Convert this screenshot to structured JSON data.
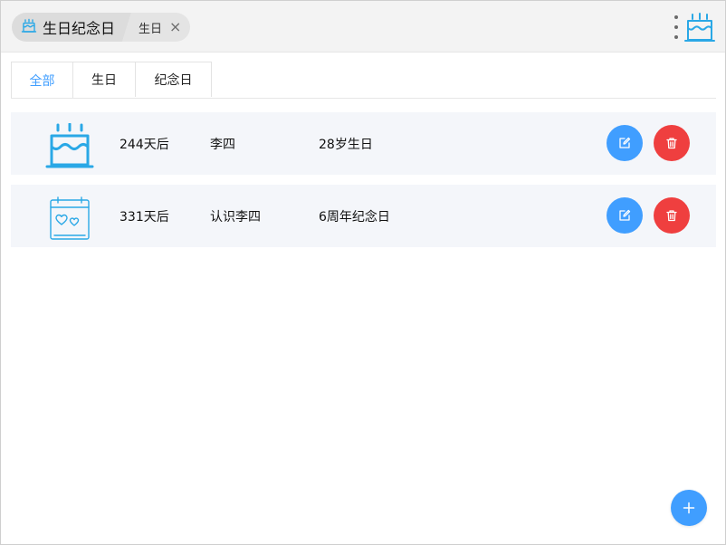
{
  "app": {
    "title": "生日纪念日"
  },
  "breadcrumb": {
    "tab_label": "生日"
  },
  "tabs": [
    {
      "label": "全部",
      "active": true
    },
    {
      "label": "生日",
      "active": false
    },
    {
      "label": "纪念日",
      "active": false
    }
  ],
  "events": [
    {
      "type_icon": "birthday-cake-icon",
      "days": "244天后",
      "name": "李四",
      "desc": "28岁生日"
    },
    {
      "type_icon": "calendar-hearts-icon",
      "days": "331天后",
      "name": "认识李四",
      "desc": "6周年纪念日"
    }
  ],
  "icons": {
    "crumb": "cake-icon",
    "close": "close-icon",
    "menu": "more-vertical-icon",
    "app_logo": "cake-icon",
    "edit": "edit-icon",
    "delete": "trash-icon",
    "add": "plus-icon"
  },
  "colors": {
    "accent": "#409eff",
    "danger": "#ef3f3f",
    "icon_blue": "#2aa8e6",
    "row_bg": "#f4f6fa",
    "topbar_bg": "#f3f3f3"
  }
}
